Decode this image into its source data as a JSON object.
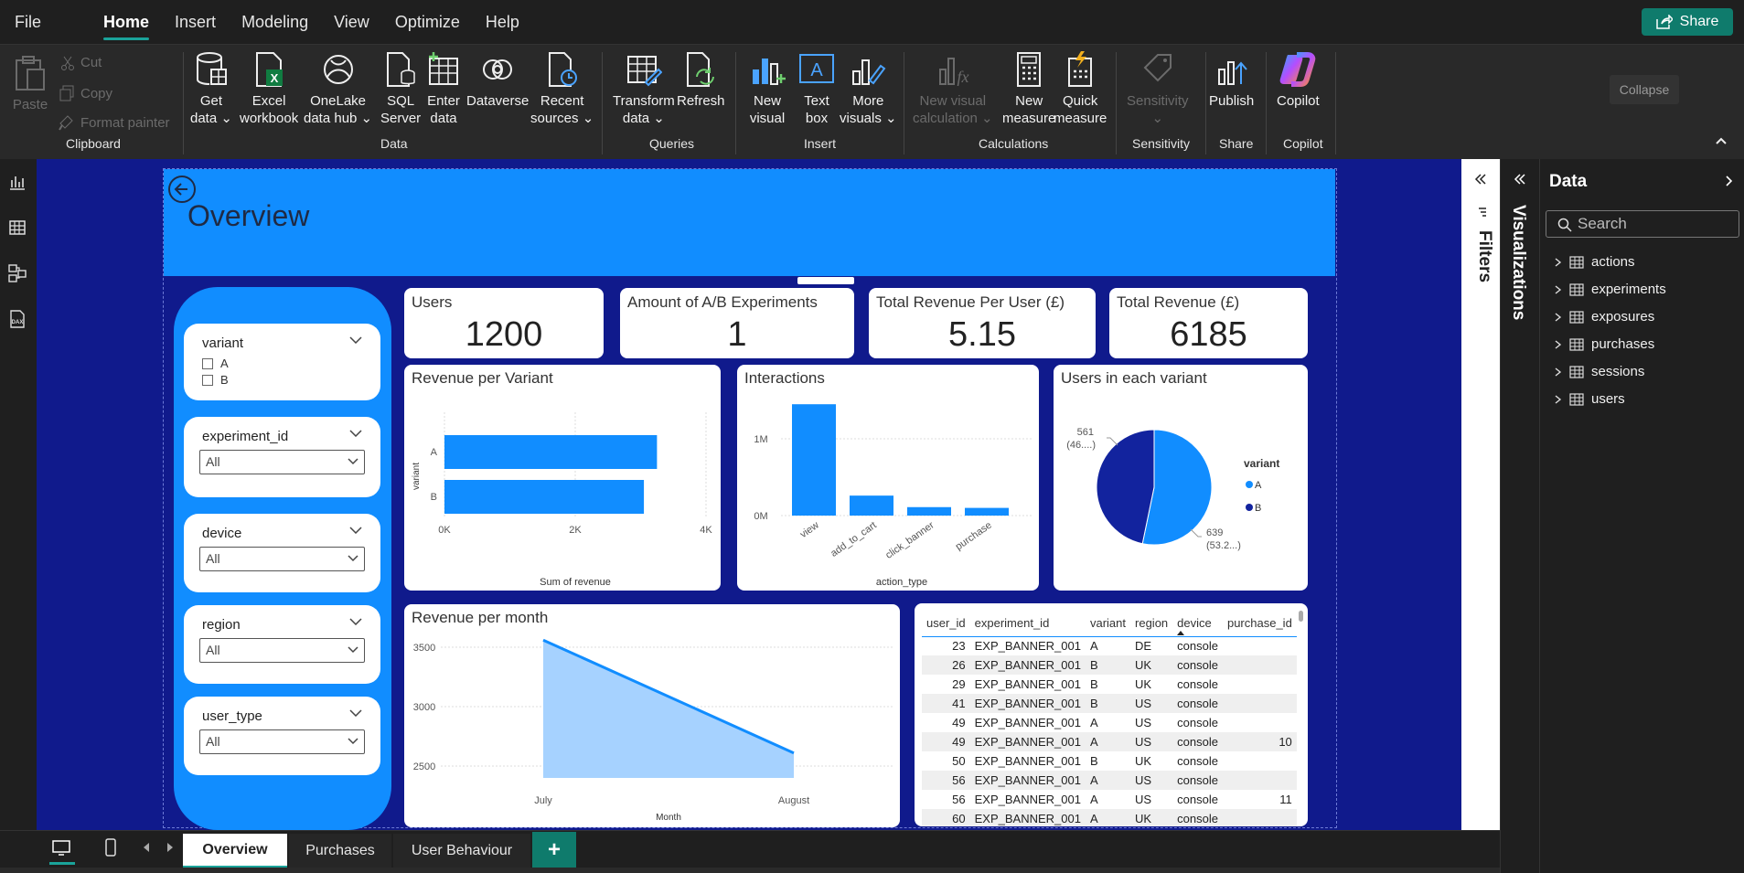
{
  "menu": [
    "File",
    "Home",
    "Insert",
    "Modeling",
    "View",
    "Optimize",
    "Help"
  ],
  "share_label": "Share",
  "ribbon": {
    "clipboard": {
      "paste": "Paste",
      "cut": "Cut",
      "copy": "Copy",
      "format_painter": "Format painter",
      "group": "Clipboard"
    },
    "data": {
      "get_data": [
        "Get",
        "data"
      ],
      "excel": [
        "Excel",
        "workbook"
      ],
      "onelake": [
        "OneLake",
        "data hub"
      ],
      "sql": [
        "SQL",
        "Server"
      ],
      "enter": [
        "Enter",
        "data"
      ],
      "dataverse": "Dataverse",
      "recent": [
        "Recent",
        "sources"
      ],
      "group": "Data"
    },
    "queries": {
      "transform": [
        "Transform",
        "data"
      ],
      "refresh": "Refresh",
      "group": "Queries"
    },
    "insert": {
      "new_visual": [
        "New",
        "visual"
      ],
      "text_box": [
        "Text",
        "box"
      ],
      "more_visuals": [
        "More",
        "visuals"
      ],
      "group": "Insert"
    },
    "calculations": {
      "new_visual_calc": [
        "New visual",
        "calculation"
      ],
      "new_measure": [
        "New",
        "measure"
      ],
      "quick_measure": [
        "Quick",
        "measure"
      ],
      "group": "Calculations"
    },
    "sensitivity": {
      "label": "Sensitivity",
      "group": "Sensitivity"
    },
    "share": {
      "publish": "Publish",
      "group": "Share"
    },
    "copilot": {
      "label": "Copilot",
      "group": "Copilot"
    },
    "collapse_tip": "Collapse"
  },
  "report": {
    "title": "Overview",
    "slicers": {
      "variant": {
        "title": "variant",
        "options": [
          "A",
          "B"
        ]
      },
      "experiment_id": {
        "title": "experiment_id",
        "value": "All"
      },
      "device": {
        "title": "device",
        "value": "All"
      },
      "region": {
        "title": "region",
        "value": "All"
      },
      "user_type": {
        "title": "user_type",
        "value": "All"
      }
    },
    "cards": [
      {
        "title": "Users",
        "value": "1200"
      },
      {
        "title": "Amount of A/B Experiments",
        "value": "1"
      },
      {
        "title": "Total Revenue Per User (£)",
        "value": "5.15"
      },
      {
        "title": "Total Revenue (£)",
        "value": "6185"
      }
    ],
    "revenue_per_variant": {
      "title": "Revenue per Variant",
      "xlabel": "Sum of revenue",
      "ylabel": "variant",
      "ticks": [
        "0K",
        "2K",
        "4K"
      ]
    },
    "interactions": {
      "title": "Interactions",
      "xlabel": "action_type",
      "ticks": [
        "1M",
        "0M"
      ]
    },
    "users_variant": {
      "title": "Users in each variant",
      "legend_title": "variant",
      "label_a": [
        "639",
        "(53.2...)"
      ],
      "label_b": [
        "561",
        "(46....)"
      ]
    },
    "revenue_month": {
      "title": "Revenue per month",
      "xlabel": "Month",
      "ticks": [
        "3500",
        "3000",
        "2500"
      ]
    },
    "table": {
      "columns": [
        "user_id",
        "experiment_id",
        "variant",
        "region",
        "device",
        "purchase_id"
      ],
      "rows": [
        [
          "23",
          "EXP_BANNER_001",
          "A",
          "DE",
          "console",
          ""
        ],
        [
          "26",
          "EXP_BANNER_001",
          "B",
          "UK",
          "console",
          ""
        ],
        [
          "29",
          "EXP_BANNER_001",
          "B",
          "UK",
          "console",
          ""
        ],
        [
          "41",
          "EXP_BANNER_001",
          "B",
          "US",
          "console",
          ""
        ],
        [
          "49",
          "EXP_BANNER_001",
          "A",
          "US",
          "console",
          ""
        ],
        [
          "49",
          "EXP_BANNER_001",
          "A",
          "US",
          "console",
          "10"
        ],
        [
          "50",
          "EXP_BANNER_001",
          "B",
          "UK",
          "console",
          ""
        ],
        [
          "56",
          "EXP_BANNER_001",
          "A",
          "US",
          "console",
          ""
        ],
        [
          "56",
          "EXP_BANNER_001",
          "A",
          "US",
          "console",
          "11"
        ],
        [
          "60",
          "EXP_BANNER_001",
          "A",
          "UK",
          "console",
          ""
        ]
      ]
    }
  },
  "chart_data": [
    {
      "type": "bar",
      "title": "Revenue per Variant",
      "categories": [
        "A",
        "B"
      ],
      "values": [
        3250,
        3050
      ],
      "xlabel": "Sum of revenue",
      "ylabel": "variant",
      "xlim": [
        0,
        4000
      ]
    },
    {
      "type": "bar",
      "title": "Interactions",
      "categories": [
        "view",
        "add_to_cart",
        "click_banner",
        "purchase"
      ],
      "values": [
        1450000,
        260000,
        110000,
        100000
      ],
      "xlabel": "action_type",
      "ylabel": "",
      "ylim": [
        0,
        1500000
      ]
    },
    {
      "type": "pie",
      "title": "Users in each variant",
      "categories": [
        "A",
        "B"
      ],
      "values": [
        639,
        561
      ],
      "legend": "variant"
    },
    {
      "type": "area",
      "title": "Revenue per month",
      "x": [
        "July",
        "August"
      ],
      "values": [
        3560,
        2610
      ],
      "xlabel": "Month",
      "ylabel": "",
      "ylim": [
        2400,
        3600
      ]
    }
  ],
  "panes": {
    "filters": "Filters",
    "visualizations": "Visualizations",
    "data": "Data",
    "search_placeholder": "Search",
    "tables": [
      "actions",
      "experiments",
      "exposures",
      "purchases",
      "sessions",
      "users"
    ]
  },
  "tabs": [
    "Overview",
    "Purchases",
    "User Behaviour"
  ],
  "colors": {
    "accent": "#118dff",
    "navy": "#12239e",
    "canvas": "#101a8c",
    "teal": "#0f7b6c"
  }
}
